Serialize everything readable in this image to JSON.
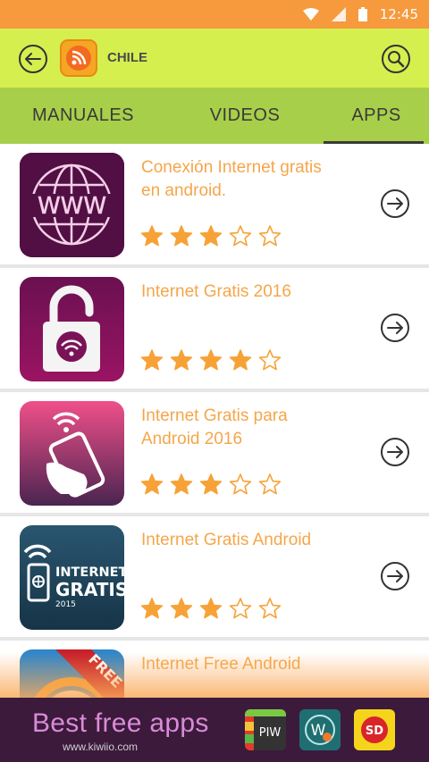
{
  "status_bar": {
    "time": "12:45"
  },
  "toolbar": {
    "country": "CHILE"
  },
  "tabs": [
    {
      "label": "MANUALES",
      "active": false
    },
    {
      "label": "VIDEOS",
      "active": false
    },
    {
      "label": "APPS",
      "active": true
    }
  ],
  "apps": [
    {
      "title": "Conexión Internet gratis en android.",
      "rating": 3,
      "max_rating": 5,
      "icon": "www-globe-icon"
    },
    {
      "title": "Internet Gratis 2016",
      "rating": 4,
      "max_rating": 5,
      "icon": "wifi-padlock-icon"
    },
    {
      "title": "Internet Gratis para Android 2016",
      "rating": 3,
      "max_rating": 5,
      "icon": "hand-phone-wifi-icon"
    },
    {
      "title": "Internet Gratis Android",
      "rating": 3,
      "max_rating": 5,
      "icon": "internet-gratis-2015-icon",
      "icon_text": {
        "line1": "INTERNET",
        "line2": "GRATIS",
        "line3": "2015"
      }
    },
    {
      "title": "Internet Free Android",
      "rating": 0,
      "max_rating": 5,
      "icon": "free-ribbon-icon",
      "icon_text": {
        "ribbon": "FREE"
      }
    }
  ],
  "ad": {
    "title": "Best free apps",
    "url": "www.kiwiio.com",
    "apps": [
      {
        "label": "PIW"
      },
      {
        "label": "W"
      },
      {
        "label": "SD"
      }
    ]
  },
  "colors": {
    "status_bar": "#f79a3e",
    "toolbar": "#d5ef4f",
    "tabs": "#a8cf4a",
    "item_title": "#f5a64a",
    "star": "#f7a237",
    "ad_background": "#3c1a3c"
  }
}
